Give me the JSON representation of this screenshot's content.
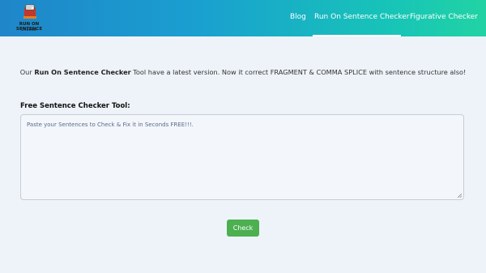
{
  "logo": {
    "title": "RUN ON SENTENCE",
    "subtitle": "Checker"
  },
  "nav": {
    "items": [
      "Blog",
      "Run On Sentence Checker",
      "Figurative Checker"
    ],
    "active": "Run On Sentence Checker"
  },
  "intro": {
    "prefix": "Our",
    "highlight": "Run On Sentence Checker",
    "suffix": "Tool have a latest version. Now it correct FRAGMENT & COMMA SPLICE with sentence structure also!"
  },
  "tool": {
    "label": "Free Sentence Checker Tool:",
    "placeholder": "Paste your Sentences to Check & Fix it in Seconds FREE!!!.",
    "button": "Check"
  },
  "colors": {
    "header_start": "#1f86c9",
    "header_end": "#21d3a4",
    "button": "#4caf50",
    "page_bg": "#eef3f9"
  }
}
